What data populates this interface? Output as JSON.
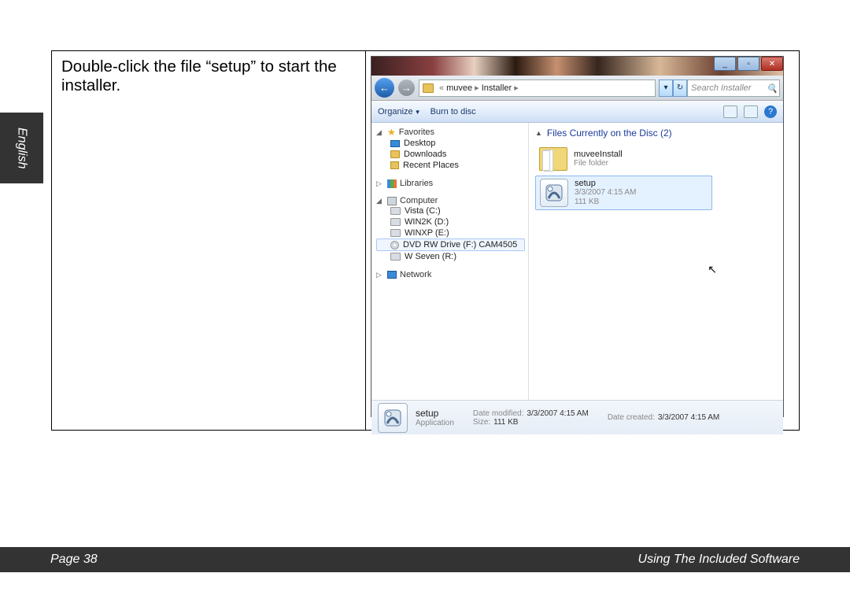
{
  "doc": {
    "language_tab": "English",
    "instruction": "Double-click the file “setup” to start the installer.",
    "footer_left": "Page 38",
    "footer_right": "Using The Included Software"
  },
  "explorer": {
    "breadcrumb": {
      "sep_prefix": "«",
      "p1": "muvee",
      "p2": "Installer",
      "arrow": "▸"
    },
    "search_placeholder": "Search Installer",
    "toolbar": {
      "organize": "Organize",
      "burn": "Burn to disc"
    },
    "sidebar": {
      "favorites": "Favorites",
      "desktop": "Desktop",
      "downloads": "Downloads",
      "recent": "Recent Places",
      "libraries": "Libraries",
      "computer": "Computer",
      "vista": "Vista (C:)",
      "win2k": "WIN2K (D:)",
      "winxp": "WINXP (E:)",
      "dvd": "DVD RW Drive (F:) CAM4505",
      "wseven": "W Seven (R:)",
      "network": "Network"
    },
    "content": {
      "header": "Files Currently on the Disc (2)",
      "folder": {
        "name": "muveeInstall",
        "sub": "File folder"
      },
      "setup": {
        "name": "setup",
        "date": "3/3/2007 4:15 AM",
        "size": "111 KB"
      }
    },
    "details": {
      "name": "setup",
      "type": "Application",
      "mod_label": "Date modified:",
      "mod_val": "3/3/2007 4:15 AM",
      "size_label": "Size:",
      "size_val": "111 KB",
      "created_label": "Date created:",
      "created_val": "3/3/2007 4:15 AM"
    }
  }
}
